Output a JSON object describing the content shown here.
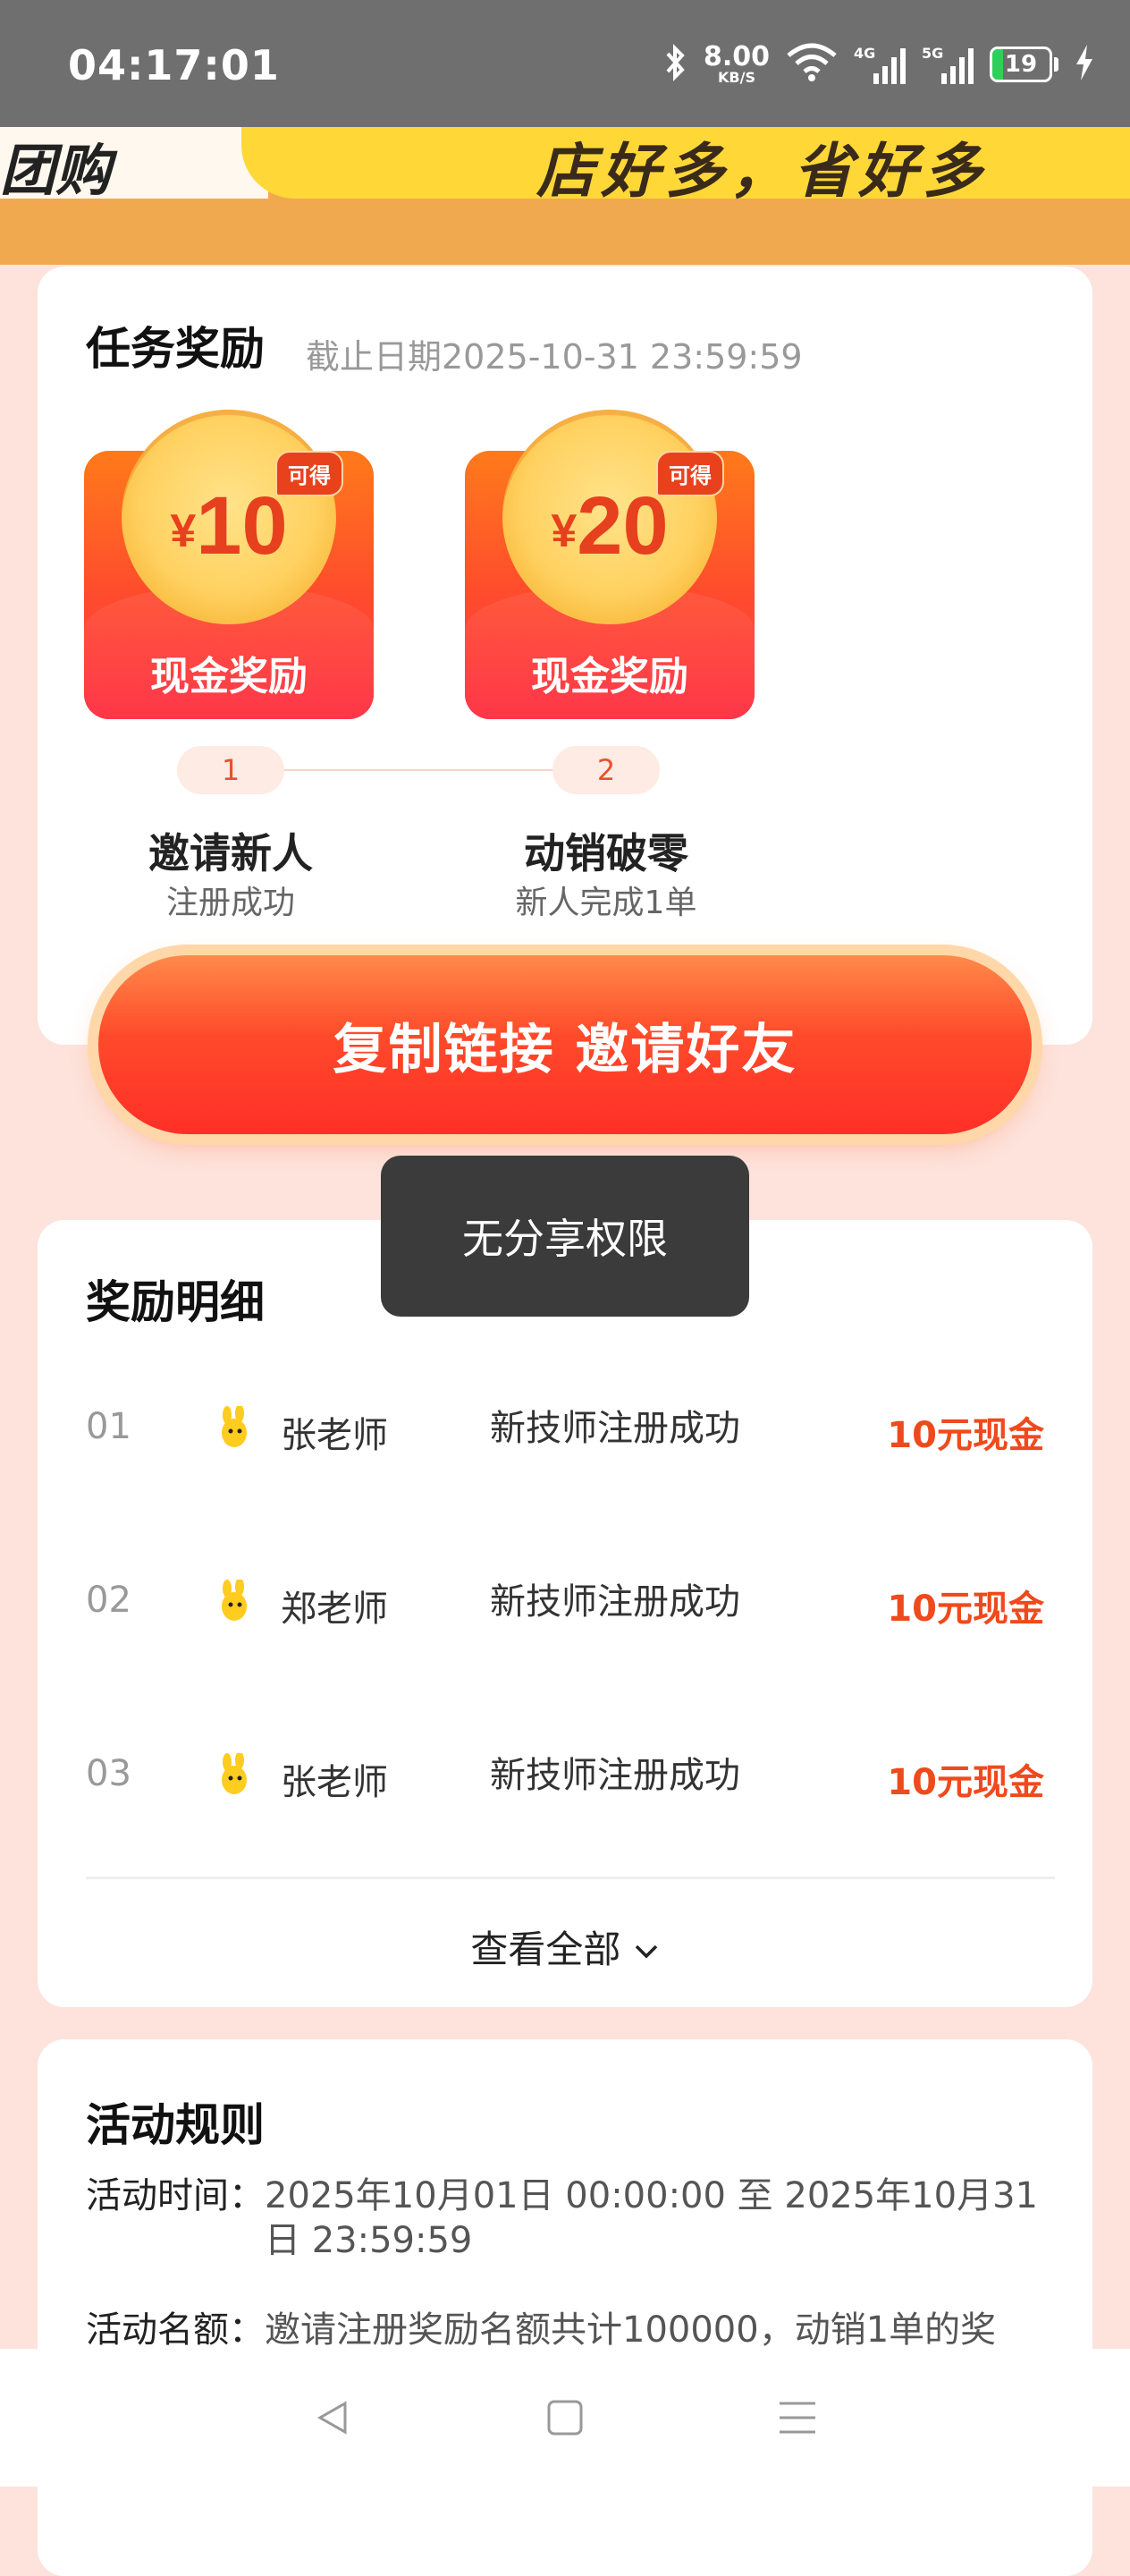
{
  "status_bar": {
    "time": "04:17:01",
    "net_speed_value": "8.00",
    "net_speed_unit": "KB/S",
    "signal1_label": "4G",
    "signal2_label": "5G",
    "battery": "19",
    "battery_level": 0.19
  },
  "banner": {
    "left_text": "团购",
    "right_text": "店好多，省好多"
  },
  "task_card": {
    "title": "任务奖励",
    "deadline": "截止日期2025-10-31 23:59:59",
    "rewards": [
      {
        "currency": "¥",
        "amount": "10",
        "badge": "可得",
        "label": "现金奖励"
      },
      {
        "currency": "¥",
        "amount": "20",
        "badge": "可得",
        "label": "现金奖励"
      }
    ],
    "steps": [
      {
        "num": "1",
        "name": "邀请新人",
        "desc": "注册成功"
      },
      {
        "num": "2",
        "name": "动销破零",
        "desc": "新人完成1单"
      }
    ]
  },
  "cta": {
    "label": "复制链接 邀请好友"
  },
  "toast": {
    "message": "无分享权限"
  },
  "rewards_detail": {
    "title": "奖励明细",
    "rows": [
      {
        "index": "01",
        "name": "张老师",
        "action": "新技师注册成功",
        "amount": "10元现金"
      },
      {
        "index": "02",
        "name": "郑老师",
        "action": "新技师注册成功",
        "amount": "10元现金"
      },
      {
        "index": "03",
        "name": "张老师",
        "action": "新技师注册成功",
        "amount": "10元现金"
      }
    ],
    "view_all": "查看全部"
  },
  "rules": {
    "title": "活动规则",
    "items": [
      {
        "key": "活动时间：",
        "value": "2025年10月01日 00:00:00 至 2025年10月31日 23:59:59"
      },
      {
        "key": "活动名额：",
        "value": "邀请注册奖励名额共计100000，动销1单的奖"
      }
    ]
  },
  "colors": {
    "accent": "#ee4a1c",
    "page_bg": "#fde3dc",
    "cta": "#ff3a28"
  }
}
